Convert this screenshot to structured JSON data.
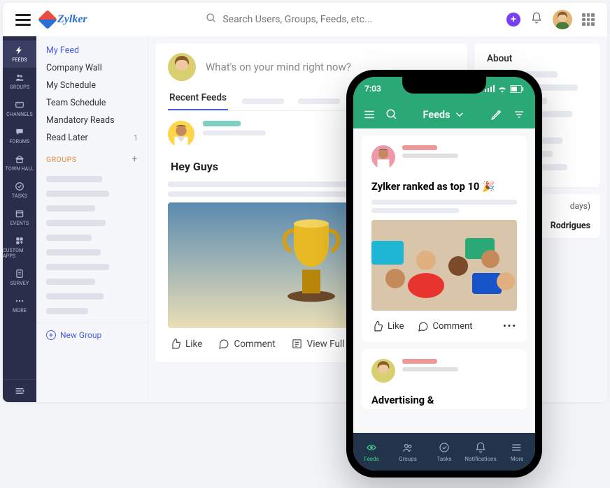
{
  "brand": "Zylker",
  "search": {
    "placeholder": "Search Users, Groups, Feeds, etc..."
  },
  "rail": [
    {
      "key": "feeds",
      "label": "Feeds",
      "active": true
    },
    {
      "key": "groups",
      "label": "Groups"
    },
    {
      "key": "channels",
      "label": "Channels"
    },
    {
      "key": "forums",
      "label": "Forums"
    },
    {
      "key": "townhall",
      "label": "Town Hall"
    },
    {
      "key": "tasks",
      "label": "Tasks"
    },
    {
      "key": "events",
      "label": "Events"
    },
    {
      "key": "customapps",
      "label": "Custom Apps"
    },
    {
      "key": "survey",
      "label": "Survey"
    },
    {
      "key": "more",
      "label": "More"
    }
  ],
  "subnav": {
    "items": [
      {
        "label": "My Feed",
        "active": true
      },
      {
        "label": "Company Wall"
      },
      {
        "label": "My Schedule"
      },
      {
        "label": "Team Schedule"
      },
      {
        "label": "Mandatory Reads"
      },
      {
        "label": "Read Later",
        "badge": "1"
      }
    ],
    "section_label": "GROUPS",
    "new_group_label": "New Group"
  },
  "composer": {
    "prompt": "What's on your mind right now?"
  },
  "tabs": {
    "recent": "Recent Feeds"
  },
  "post": {
    "title": "Hey Guys",
    "like": "Like",
    "comment": "Comment",
    "view_full": "View Full Post"
  },
  "about": {
    "heading": "About",
    "days_suffix": "days)",
    "name": "Rodrigues"
  },
  "phone": {
    "time": "7:03",
    "header_title": "Feeds",
    "post_title": "Zylker ranked as top 10 🎉",
    "like": "Like",
    "comment": "Comment",
    "second_post_title": "Advertising &",
    "nav": [
      {
        "key": "feeds",
        "label": "Feeds",
        "active": true
      },
      {
        "key": "groups",
        "label": "Groups"
      },
      {
        "key": "tasks",
        "label": "Tasks"
      },
      {
        "key": "notifications",
        "label": "Notifications"
      },
      {
        "key": "more",
        "label": "More"
      }
    ]
  }
}
